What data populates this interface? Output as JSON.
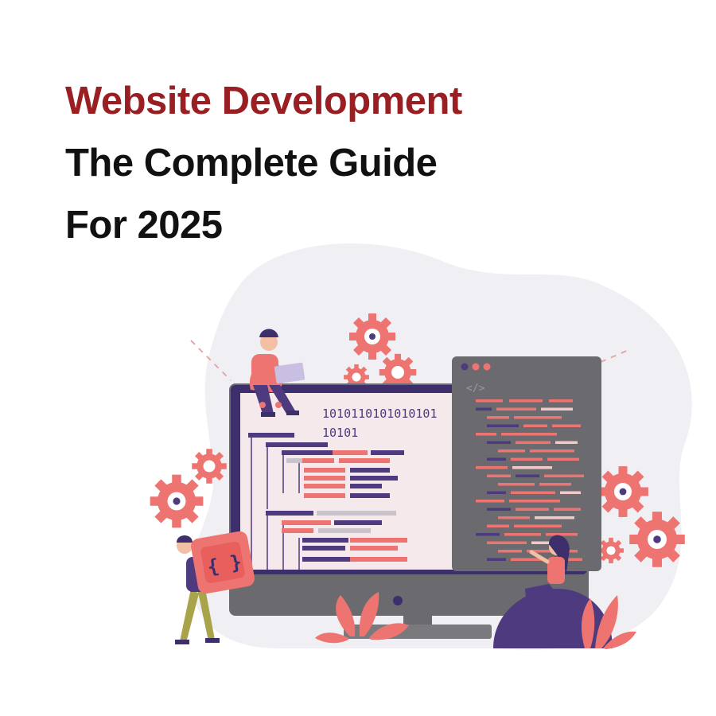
{
  "heading": {
    "line1": "Website Development",
    "line2": "The Complete Guide",
    "line3": "For 2025"
  },
  "illustration": {
    "binary_line1": "1010110101010101",
    "binary_line2": "10101",
    "code_tag": "</>",
    "brace_icon": "{ }"
  },
  "colors": {
    "accent": "#9a1f23",
    "coral": "#ee7471",
    "purple": "#4e3a7f",
    "editor": "#6b6a6e",
    "blob": "#f0eff4"
  }
}
